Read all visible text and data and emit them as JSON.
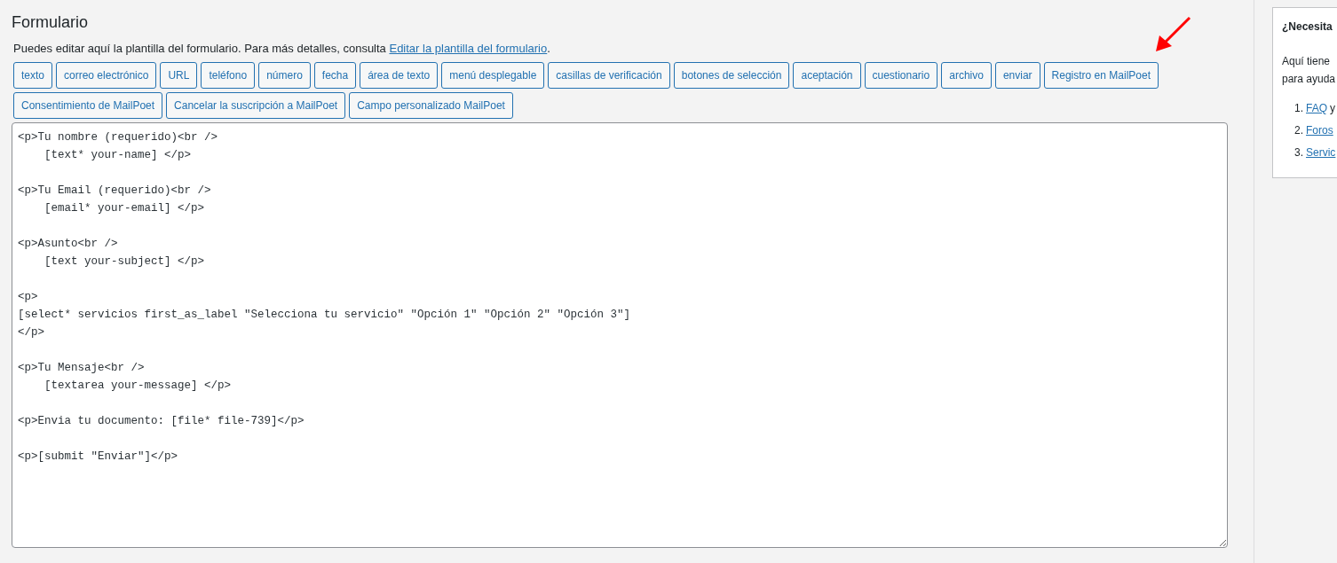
{
  "form_panel": {
    "title": "Formulario",
    "description": "Puedes editar aquí la plantilla del formulario. Para más detalles, consulta ",
    "description_link": "Editar la plantilla del formulario",
    "description_end": ".",
    "tag_buttons": [
      "texto",
      "correo electrónico",
      "URL",
      "teléfono",
      "número",
      "fecha",
      "área de texto",
      "menú desplegable",
      "casillas de verificación",
      "botones de selección",
      "aceptación",
      "cuestionario",
      "archivo",
      "enviar",
      "Registro en MailPoet",
      "Consentimiento de MailPoet",
      "Cancelar la suscripción a MailPoet",
      "Campo personalizado MailPoet"
    ],
    "editor_blocks": [
      [
        "<p>Tu nombre (requerido)<br />",
        "    [text* your-name] </p>"
      ],
      [
        "<p>Tu Email (requerido)<br />",
        "    [email* your-email] </p>"
      ],
      [
        "<p>Asunto<br />",
        "    [text your-subject] </p>"
      ],
      [
        "<p>",
        "[select* servicios first_as_label \"Selecciona tu servicio\" \"Opción 1\" \"Opción 2\" \"Opción 3\"]",
        "</p>"
      ],
      [
        "<p>Tu Mensaje<br />",
        "    [textarea your-message] </p>"
      ],
      [
        "<p>Envia tu documento: [file* file-739]</p>"
      ],
      [
        "<p>[submit \"Enviar\"]</p>"
      ]
    ]
  },
  "help_box": {
    "title": "¿Necesita",
    "text_lines": [
      "Aquí tiene",
      "para ayuda"
    ],
    "items": [
      {
        "number": "1.",
        "link": "FAQ",
        "rest": "y"
      },
      {
        "number": "2.",
        "link": "Foros"
      },
      {
        "number": "3.",
        "link": "Servic"
      }
    ]
  }
}
